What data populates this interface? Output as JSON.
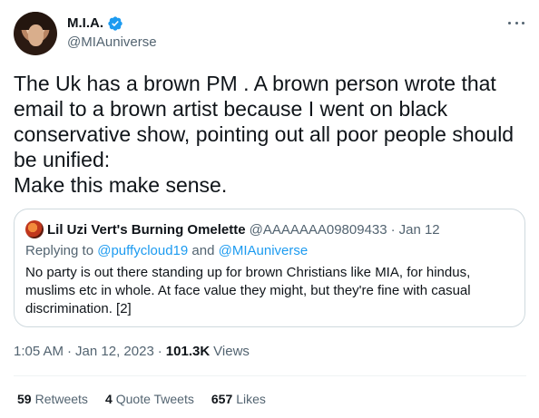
{
  "author": {
    "display_name": "M.I.A.",
    "handle": "@MIAuniverse",
    "verified": true,
    "avatar_icon": "profile-photo"
  },
  "tweet": {
    "text": "The Uk has a brown PM . A brown person wrote that email to a brown artist because I went on black conservative show, pointing out all poor people should be unified:\nMake this make sense."
  },
  "quoted_tweet": {
    "display_name": "Lil Uzi Vert's Burning Omelette",
    "handle": "@AAAAAAA09809433",
    "separator": "·",
    "date": "Jan 12",
    "replying_prefix": "Replying to ",
    "reply_mention_1": "@puffycloud19",
    "reply_and": " and ",
    "reply_mention_2": "@MIAuniverse",
    "text": "No party is out there standing up for brown Christians like MIA, for hindus, muslims etc in whole. At face value they might, but they're fine with casual discrimination. [2]"
  },
  "meta": {
    "time": "1:05 AM",
    "sep": "·",
    "date": "Jan 12, 2023",
    "views_count": "101.3K",
    "views_label": "Views"
  },
  "stats": {
    "retweets_count": "59",
    "retweets_label": "Retweets",
    "quotes_count": "4",
    "quotes_label": "Quote Tweets",
    "likes_count": "657",
    "likes_label": "Likes"
  },
  "colors": {
    "accent": "#1d9bf0",
    "text": "#0f1419",
    "secondary": "#536471",
    "border": "#cfd9de"
  }
}
